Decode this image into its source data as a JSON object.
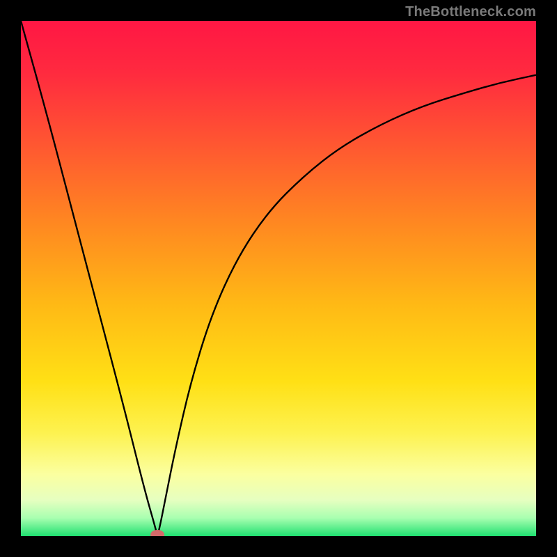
{
  "watermark": "TheBottleneck.com",
  "chart_data": {
    "type": "line",
    "title": "",
    "xlabel": "",
    "ylabel": "",
    "xlim": [
      0,
      1
    ],
    "ylim": [
      0,
      100
    ],
    "background_gradient": {
      "stops": [
        {
          "pos": 0.0,
          "color": "#ff1744"
        },
        {
          "pos": 0.1,
          "color": "#ff2a3f"
        },
        {
          "pos": 0.25,
          "color": "#ff5a30"
        },
        {
          "pos": 0.4,
          "color": "#ff8a20"
        },
        {
          "pos": 0.55,
          "color": "#ffb915"
        },
        {
          "pos": 0.7,
          "color": "#ffe015"
        },
        {
          "pos": 0.8,
          "color": "#fdf250"
        },
        {
          "pos": 0.88,
          "color": "#fbffa0"
        },
        {
          "pos": 0.93,
          "color": "#e6ffc0"
        },
        {
          "pos": 0.965,
          "color": "#a8ffb0"
        },
        {
          "pos": 1.0,
          "color": "#20e070"
        }
      ]
    },
    "minimum": {
      "x": 0.265,
      "y": 0
    },
    "series": [
      {
        "name": "bottleneck-curve",
        "x": [
          0.0,
          0.05,
          0.1,
          0.15,
          0.2,
          0.24,
          0.26,
          0.265,
          0.27,
          0.28,
          0.3,
          0.33,
          0.37,
          0.42,
          0.48,
          0.55,
          0.62,
          0.7,
          0.78,
          0.86,
          0.93,
          1.0
        ],
        "y": [
          100,
          82,
          63,
          44,
          25,
          9,
          2,
          0,
          2,
          7,
          17,
          30,
          43,
          54,
          63,
          70,
          75.5,
          80,
          83.5,
          86,
          88,
          89.5
        ]
      }
    ],
    "marker": {
      "x": 0.265,
      "y": 0,
      "color": "#d46a6a",
      "rx": 10,
      "ry": 7
    }
  }
}
